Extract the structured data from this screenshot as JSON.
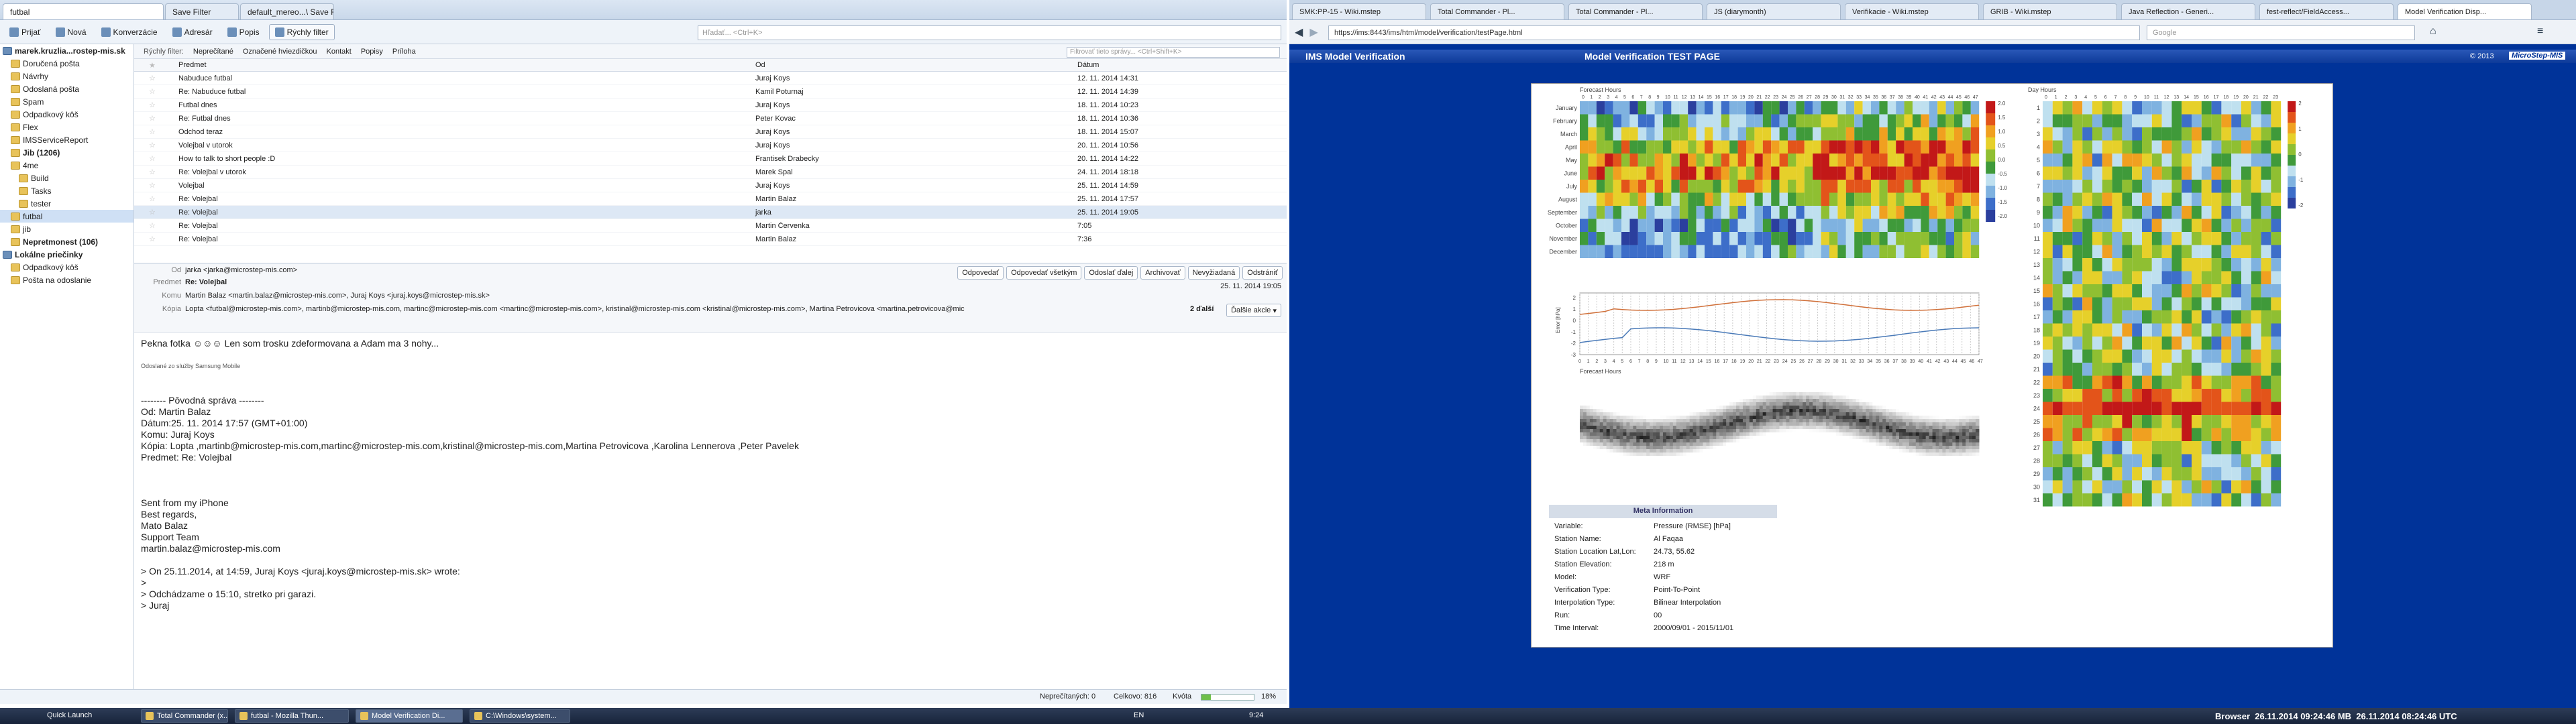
{
  "thunderbird": {
    "tabs": [
      "futbal",
      "Save Filter",
      "default_mereo...\\ Save Fu..."
    ],
    "toolbar": [
      {
        "label": "Prijať",
        "icon": "download-icon"
      },
      {
        "label": "Nová",
        "icon": "pencil-icon"
      },
      {
        "label": "Konverzácie",
        "icon": "chat-icon"
      },
      {
        "label": "Adresár",
        "icon": "address-book-icon"
      },
      {
        "label": "Popis",
        "icon": "tag-icon"
      },
      {
        "label": "Rýchly filter",
        "icon": "filter-icon"
      }
    ],
    "search_placeholder": "Hľadať... <Ctrl+K>",
    "folders": [
      {
        "label": "marek.kruzlia...rostep-mis.sk",
        "level": 0,
        "bold": true,
        "type": "account"
      },
      {
        "label": "Doručená pošta",
        "level": 1
      },
      {
        "label": "Návrhy",
        "level": 1
      },
      {
        "label": "Odoslaná pošta",
        "level": 1
      },
      {
        "label": "Spam",
        "level": 1
      },
      {
        "label": "Odpadkový kôš",
        "level": 1
      },
      {
        "label": "Flex",
        "level": 1
      },
      {
        "label": "IMSServiceReport",
        "level": 1
      },
      {
        "label": "Jib (1206)",
        "level": 1,
        "bold": true
      },
      {
        "label": "4me",
        "level": 1
      },
      {
        "label": "Build",
        "level": 2
      },
      {
        "label": "Tasks",
        "level": 2
      },
      {
        "label": "tester",
        "level": 2
      },
      {
        "label": "futbal",
        "level": 1,
        "selected": true
      },
      {
        "label": "jib",
        "level": 1
      },
      {
        "label": "Nepretmonest (106)",
        "level": 1,
        "bold": true
      },
      {
        "label": "Lokálne priečinky",
        "level": 0,
        "bold": true,
        "type": "account"
      },
      {
        "label": "Odpadkový kôš",
        "level": 1
      },
      {
        "label": "Pošta na odoslanie",
        "level": 1
      }
    ],
    "quickfilter": {
      "items": [
        "Rýchly filter:",
        "Neprečítané",
        "Označené hviezdičkou",
        "Kontakt",
        "Popisy",
        "Príloha"
      ],
      "search_placeholder": "Filtrovať tieto správy... <Ctrl+Shift+K>"
    },
    "columns": {
      "subject": "Predmet",
      "from": "Od",
      "date": "Dátum"
    },
    "messages": [
      {
        "subject": "Nabuduce futbal",
        "from": "Juraj Koys",
        "date": "12. 11. 2014 14:31"
      },
      {
        "subject": "Re: Nabuduce futbal",
        "from": "Kamil Poturnaj",
        "date": "12. 11. 2014 14:39"
      },
      {
        "subject": "Futbal dnes",
        "from": "Juraj Koys",
        "date": "18. 11. 2014 10:23"
      },
      {
        "subject": "Re: Futbal dnes",
        "from": "Peter Kovac",
        "date": "18. 11. 2014 10:36"
      },
      {
        "subject": "Odchod teraz",
        "from": "Juraj Koys",
        "date": "18. 11. 2014 15:07"
      },
      {
        "subject": "Volejbal v utorok",
        "from": "Juraj Koys",
        "date": "20. 11. 2014 10:56"
      },
      {
        "subject": "How to talk to short people :D",
        "from": "Frantisek Drabecky",
        "date": "20. 11. 2014 14:22"
      },
      {
        "subject": "Re: Volejbal v utorok",
        "from": "Marek Spal",
        "date": "24. 11. 2014 18:18"
      },
      {
        "subject": "Volejbal",
        "from": "Juraj Koys",
        "date": "25. 11. 2014 14:59"
      },
      {
        "subject": "Re: Volejbal",
        "from": "Martin Balaz",
        "date": "25. 11. 2014 17:57"
      },
      {
        "subject": "Re: Volejbal",
        "from": "jarka",
        "date": "25. 11. 2014 19:05",
        "selected": true
      },
      {
        "subject": "Re: Volejbal",
        "from": "Martin Červenka",
        "date": "7:05"
      },
      {
        "subject": "Re: Volejbal",
        "from": "Martin Balaz",
        "date": "7:36"
      }
    ],
    "header": {
      "from_label": "Od",
      "from": "jarka <jarka@microstep-mis.com>",
      "subject_label": "Predmet",
      "subject": "Re: Volejbal",
      "to_label": "Komu",
      "to": "Martin Balaz <martin.balaz@microstep-mis.com>, Juraj Koys <juraj.koys@microstep-mis.sk>",
      "cc_label": "Kópia",
      "cc": "Lopta <futbal@microstep-mis.com>, martinb@microstep-mis.com, martinc@microstep-mis.com <martinc@microstep-mis.com>, kristinal@microstep-mis.com <kristinal@microstep-mis.com>, Martina Petrovicova <martina.petrovicova@mic",
      "cc_more": "2 ďalší",
      "date": "25. 11. 2014 19:05",
      "more_actions": "Ďalšie akcie",
      "actions": [
        "Odpovedať",
        "Odpovedať všetkým",
        "Odoslať ďalej",
        "Archivovať",
        "Nevyžiadaná",
        "Odstrániť"
      ]
    },
    "body": [
      "Pekna fotka ☺☺☺ Len som trosku zdeformovana a Adam ma 3 nohy...",
      "",
      "Odoslané zo služby Samsung Mobile",
      "",
      "",
      "-------- Pôvodná správa --------",
      "Od: Martin Balaz",
      "Dátum:25. 11. 2014 17:57 (GMT+01:00)",
      "Komu: Juraj Koys",
      "Kópia: Lopta ,martinb@microstep-mis.com,martinc@microstep-mis.com,kristinal@microstep-mis.com,Martina Petrovicova ,Karolina Lennerova ,Peter Pavelek",
      "Predmet: Re: Volejbal",
      "",
      "",
      "",
      "Sent from my iPhone",
      "Best regards,",
      "Mato Balaz",
      "Support Team",
      "martin.balaz@microstep-mis.com",
      "",
      "> On 25.11.2014, at 14:59, Juraj Koys <juraj.koys@microstep-mis.sk> wrote:",
      ">",
      "> Odchádzame o 15:10, stretko pri garazi.",
      "> Juraj"
    ],
    "status": {
      "unread": "Neprečítaných: 0",
      "total": "Celkovo: 816",
      "quota_label": "Kvóta",
      "quota_pct": 18,
      "quota_text": "18%"
    }
  },
  "firefox": {
    "tabs": [
      "SMK:PP-15 - Wiki.mstep",
      "Total Commander - Pl...",
      "Total Commander - Pl...",
      "JS (diarymonth)",
      "Verifikacie - Wiki.mstep",
      "GRIB - Wiki.mstep",
      "Java Reflection - Generi...",
      "fest-reflect/FieldAccess...",
      "Model Verification Disp..."
    ],
    "url": "https://ims:8443/ims/html/model/verification/testPage.html",
    "google_placeholder": "Google",
    "ims_title": "IMS  Model Verification",
    "page_title": "Model Verification TEST PAGE",
    "copyright": "© 2013",
    "brand": "MicroStep-MIS",
    "left_heatmap": {
      "axis_title": "Forecast Hours",
      "hours": [
        "0",
        "1",
        "2",
        "3",
        "4",
        "5",
        "6",
        "7",
        "8",
        "9",
        "10",
        "11",
        "12",
        "13",
        "14",
        "15",
        "16",
        "17",
        "18",
        "19",
        "20",
        "21",
        "22",
        "23",
        "24",
        "25",
        "26",
        "27",
        "28",
        "29",
        "30",
        "31",
        "32",
        "33",
        "34",
        "35",
        "36",
        "37",
        "38",
        "39",
        "40",
        "41",
        "42",
        "43",
        "44",
        "45",
        "46",
        "47"
      ],
      "months": [
        "January",
        "February",
        "March",
        "April",
        "May",
        "June",
        "July",
        "August",
        "September",
        "October",
        "November",
        "December"
      ],
      "scale": [
        "2.0",
        "1.5",
        "1.0",
        "0.5",
        "0.0",
        "-0.5",
        "-1.0",
        "-1.5",
        "-2.0"
      ]
    },
    "line_chart": {
      "ylabel": "Error [hPa]",
      "xlabel": "Forecast Hours",
      "yticks": [
        "2",
        "1",
        "0",
        "-1",
        "-2",
        "-3"
      ]
    },
    "right_heatmap": {
      "axis_title": "Day Hours",
      "hours": [
        "0",
        "1",
        "2",
        "3",
        "4",
        "5",
        "6",
        "7",
        "8",
        "9",
        "10",
        "11",
        "12",
        "13",
        "14",
        "15",
        "16",
        "17",
        "18",
        "19",
        "20",
        "21",
        "22",
        "23"
      ],
      "days": [
        "1",
        "2",
        "3",
        "4",
        "5",
        "6",
        "7",
        "8",
        "9",
        "10",
        "11",
        "12",
        "13",
        "14",
        "15",
        "16",
        "17",
        "18",
        "19",
        "20",
        "21",
        "22",
        "23",
        "24",
        "25",
        "26",
        "27",
        "28",
        "29",
        "30",
        "31"
      ],
      "scale": [
        "2",
        "1",
        "0",
        "-1",
        "-2"
      ]
    },
    "meta_title": "Meta Information",
    "meta": [
      {
        "k": "Variable:",
        "v": "Pressure (RMSE) [hPa]"
      },
      {
        "k": "Station Name:",
        "v": "Al Faqaa"
      },
      {
        "k": "Station Location Lat,Lon:",
        "v": "24.73, 55.62"
      },
      {
        "k": "Station Elevation:",
        "v": "218 m"
      },
      {
        "k": "Model:",
        "v": "WRF"
      },
      {
        "k": "Verification Type:",
        "v": "Point-To-Point"
      },
      {
        "k": "Interpolation Type:",
        "v": "Bilinear Interpolation"
      },
      {
        "k": "Run:",
        "v": "00"
      },
      {
        "k": "Time Interval:",
        "v": "2000/09/01 - 2015/11/01"
      }
    ]
  },
  "taskbar": {
    "quick_launch": "Quick Launch",
    "tasks": [
      "Total Commander (x...",
      "futbal - Mozilla Thun...",
      "Model Verification Di...",
      "C:\\Windows\\system..."
    ],
    "lang": "EN",
    "time": "9:24",
    "clock_right": "Browser  26.11.2014 09:24:46 MB  26.11.2014 08:24:46 UTC"
  }
}
